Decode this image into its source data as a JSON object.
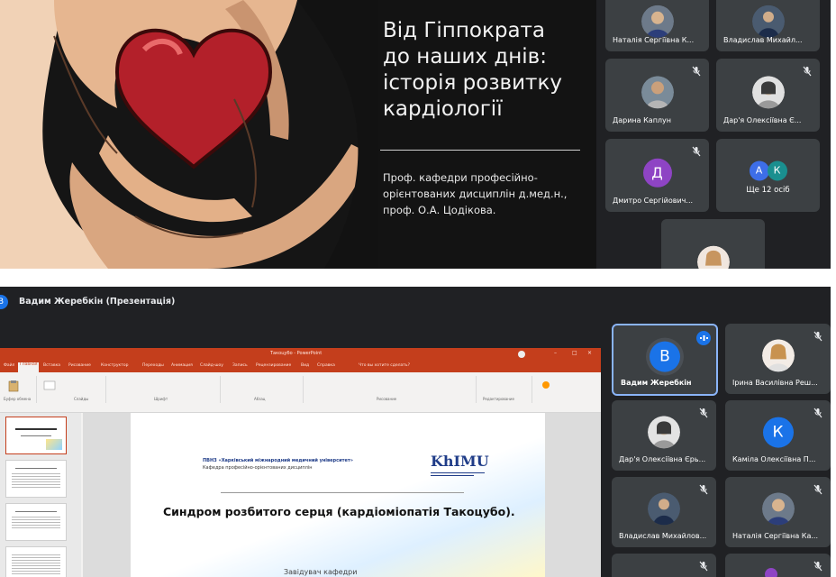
{
  "top_call": {
    "slide": {
      "title_lines": [
        "Від Гіппократа",
        "до наших днів:",
        "історія розвитку",
        "кардіології"
      ],
      "subtitle_lines": [
        "Проф. кафедри професійно-",
        "орієнтованих дисциплін д.мед.н.,",
        "проф. О.А. Цодікова."
      ]
    },
    "participants": [
      {
        "name": "Наталія Сергіївна К...",
        "avatar": "photo",
        "muted": false
      },
      {
        "name": "Владислав Михайл...",
        "avatar": "photo",
        "muted": false
      },
      {
        "name": "Дарина Каплун",
        "avatar": "photo",
        "muted": true
      },
      {
        "name": "Дар'я Олексіївна Є...",
        "avatar": "photo",
        "muted": true
      },
      {
        "name": "Дмитро Сергійович...",
        "avatar": "letter",
        "letter": "Д",
        "color": "#8e44c4",
        "muted": true
      },
      {
        "name": "Ще 12 осіб",
        "avatar": "group",
        "letters": [
          "А",
          "К"
        ],
        "colors": [
          "#3d6ee8",
          "#1a8f8f"
        ],
        "muted": false
      },
      {
        "name": "",
        "avatar": "photo",
        "muted": false
      }
    ]
  },
  "bottom_call": {
    "presenter": {
      "initial": "В",
      "label": "Вадим Жеребкін (Презентація)"
    },
    "powerpoint": {
      "window_title": "Такоцубо - PowerPoint",
      "tabs": [
        "Файл",
        "Главная",
        "Вставка",
        "Рисование",
        "Конструктор",
        "Переходы",
        "Анимация",
        "Слайд-шоу",
        "Запись",
        "Рецензирование",
        "Вид",
        "Справка",
        "Что вы хотите сделать?"
      ],
      "ribbon_groups": [
        "Буфер обмена",
        "Слайды",
        "Шрифт",
        "Абзац",
        "Рисование",
        "Редактирование"
      ]
    },
    "slide": {
      "org_line1": "ПВНЗ «Харківський міжнародний медичний університет»",
      "org_line2": "Кафедра професійно-орієнтованих дисциплін",
      "logo": "KhIMU",
      "title": "Синдром розбитого серця (кардіоміопатія Такоцубо).",
      "bottom_text": "Завідувач кафедри"
    },
    "participants": [
      {
        "name": "Вадим Жеребкін",
        "avatar": "letter",
        "letter": "В",
        "color": "#1a73e8",
        "speaking": true
      },
      {
        "name": "Ірина Василівна Реш...",
        "avatar": "photo",
        "muted": true
      },
      {
        "name": "Дар'я Олексіївна Єрь...",
        "avatar": "photo",
        "muted": true
      },
      {
        "name": "Каміла Олексіївна П...",
        "avatar": "letter",
        "letter": "К",
        "color": "#1a73e8",
        "muted": true
      },
      {
        "name": "Владислав Михайлов...",
        "avatar": "photo",
        "muted": true
      },
      {
        "name": "Наталія Сергіївна Ка...",
        "avatar": "photo",
        "muted": true
      }
    ]
  }
}
